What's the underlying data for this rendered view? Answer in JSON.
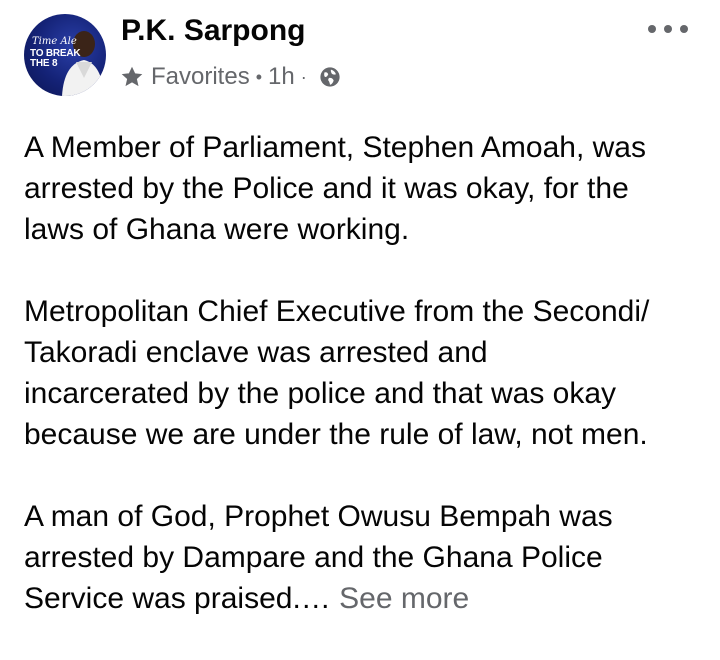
{
  "post": {
    "author_name": "P.K. Sarpong",
    "audience": "Favorites",
    "separator": "•",
    "time": "1h",
    "time_separator": "·",
    "avatar_text": {
      "line1": "Time Ale",
      "line2": "TO BREAK\nTHE 8"
    },
    "paragraphs": [
      "A Member of Parliament, Stephen Amoah, was\narrested by the Police and it was okay, for the\nlaws of Ghana were working.",
      "Metropolitan Chief Executive from the Secondi/\nTakoradi enclave was arrested and\nincarcerated by the police and that was okay\nbecause we are under the rule of law, not men."
    ],
    "last_paragraph": "A man of God, Prophet Owusu Bempah was\narrested by Dampare and the Ghana Police\nService was praised.…",
    "see_more": "See more"
  },
  "icons": {
    "audience": "star-icon",
    "privacy": "globe-icon",
    "menu": "more-horizontal-icon"
  },
  "colors": {
    "text_primary": "#050505",
    "text_secondary": "#65676b",
    "avatar_bg": "#142276"
  }
}
